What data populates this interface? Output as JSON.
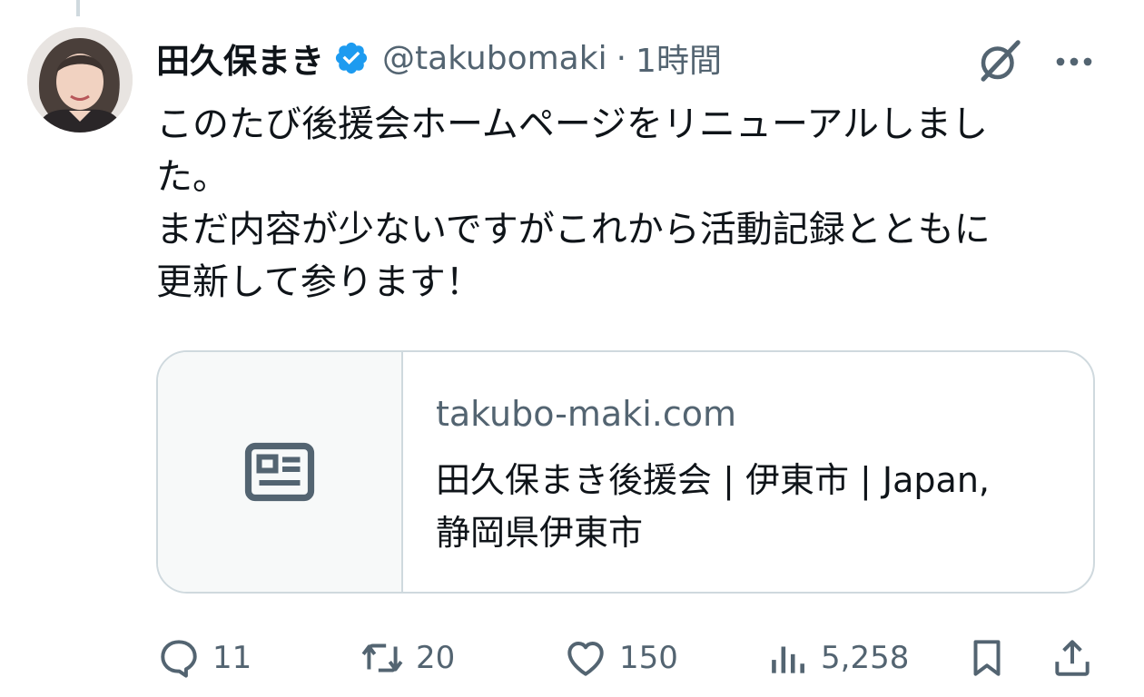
{
  "tweet": {
    "author_name": "田久保まき",
    "handle": "@takubomaki",
    "separator": "·",
    "time": "1時間",
    "text_lines": [
      "このたび後援会ホームページをリニューアルしまし",
      "た。",
      "まだ内容が少ないですがこれから活動記録とともに",
      "更新して参ります！"
    ]
  },
  "link_card": {
    "domain": "takubo-maki.com",
    "title_lines": [
      "田久保まき後援会 | 伊東市 | Japan,",
      "静岡県伊東市"
    ]
  },
  "actions": {
    "replies": "11",
    "reposts": "20",
    "likes": "150",
    "views": "5,258"
  },
  "icons": {
    "verified": "verified-badge-icon",
    "grok": "grok-icon",
    "more": "more-icon",
    "card_thumb": "article-icon",
    "reply": "reply-icon",
    "repost": "repost-icon",
    "like": "heart-icon",
    "views": "analytics-icon",
    "bookmark": "bookmark-icon",
    "share": "share-icon"
  },
  "colors": {
    "verified_blue": "#1d9bf0",
    "secondary_text": "#536471",
    "border": "#cfd9de"
  }
}
